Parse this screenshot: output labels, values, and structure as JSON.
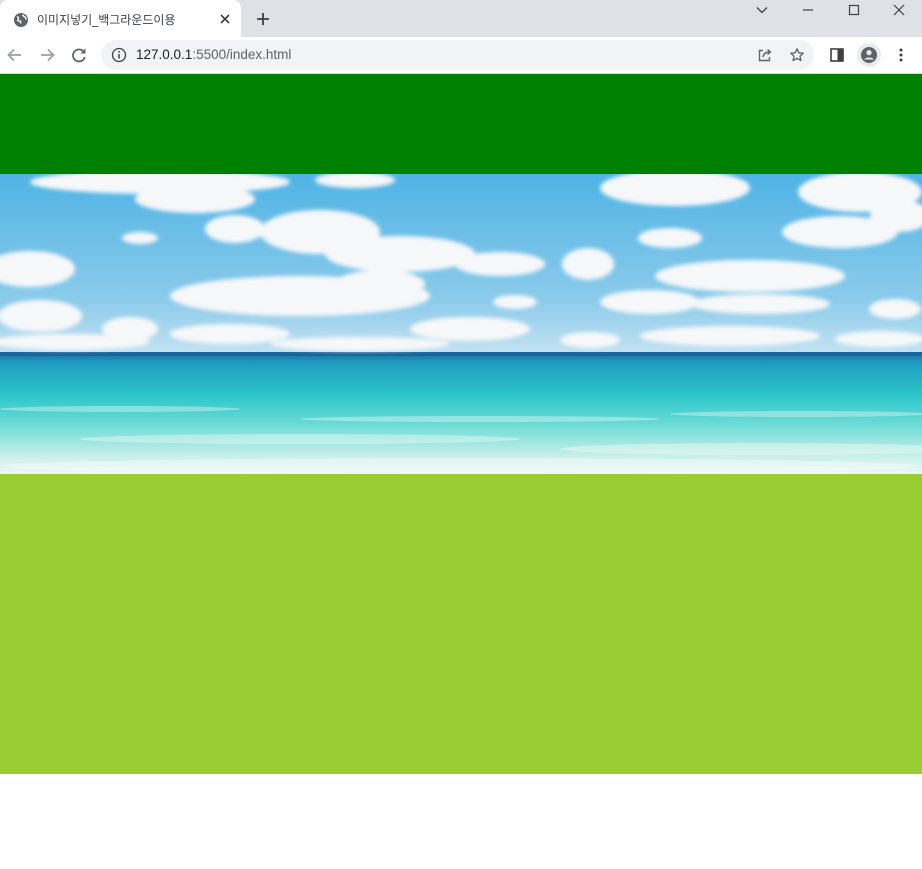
{
  "browser": {
    "tab_title": "이미지넣기_백그라운드이용",
    "url_host": "127.0.0.1",
    "url_path": ":5500/index.html"
  },
  "icons": {
    "favicon": "globe-icon",
    "tab_close": "close-icon",
    "new_tab": "plus-icon",
    "tab_search": "chevron-down-icon",
    "minimize": "minimize-icon",
    "maximize": "maximize-icon",
    "window_close": "window-close-icon",
    "back": "arrow-left-icon",
    "forward": "arrow-right-icon",
    "reload": "reload-icon",
    "site_info": "info-icon",
    "share": "share-icon",
    "bookmark": "star-icon",
    "side_panel": "side-panel-icon",
    "profile": "person-icon",
    "menu": "kebab-menu-icon"
  },
  "colors": {
    "box_top": "#008000",
    "box_bottom": "#9acd32",
    "sky_top": "#4fb6e6",
    "sea": "#2cc6c9"
  }
}
